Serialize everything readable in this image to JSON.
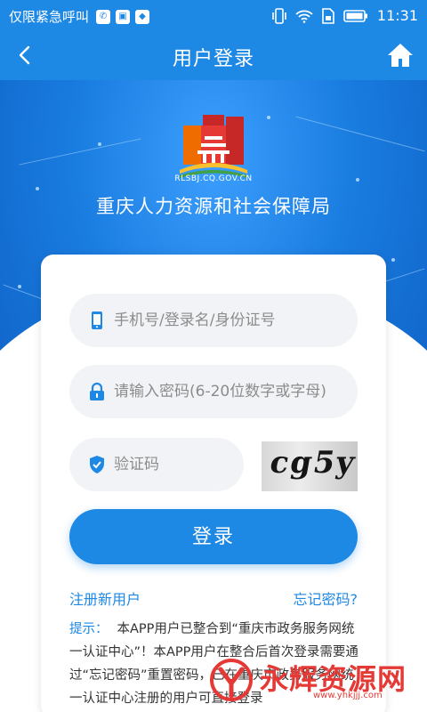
{
  "status_bar": {
    "carrier": "仅限紧急呼叫",
    "time": "11:31",
    "icons": [
      "sim-app-icon",
      "image-icon",
      "shield-icon",
      "vibrate-icon",
      "wifi-icon",
      "sim-card-icon",
      "battery-icon"
    ]
  },
  "header": {
    "title": "用户登录",
    "back_icon": "back-arrow-icon",
    "home_icon": "home-icon"
  },
  "brand": {
    "domain": "RLSBJ.CQ.GOV.CN",
    "org_name": "重庆人力资源和社会保障局"
  },
  "form": {
    "username": {
      "placeholder": "手机号/登录名/身份证号",
      "value": ""
    },
    "password": {
      "placeholder": "请输入密码(6-20位数字或字母)",
      "value": ""
    },
    "captcha": {
      "placeholder": "验证码",
      "value": "",
      "image_text": "cg5y"
    },
    "login_label": "登录",
    "register_label": "注册新用户",
    "forgot_label": "忘记密码?"
  },
  "notice": {
    "label": "提示：",
    "text": "本APP用户已整合到“重庆市政务服务网统一认证中心”！本APP用户在整合后首次登录需要通过“忘记密码”重置密码，已在重庆市政务服务网统一认证中心注册的用户可直接登录"
  },
  "watermark": {
    "brand": "永辉资源网",
    "url": "www.yhkjjj.com"
  },
  "colors": {
    "primary": "#1e88e5",
    "hero_dark": "#0e5fc4",
    "watermark": "#e53935"
  }
}
